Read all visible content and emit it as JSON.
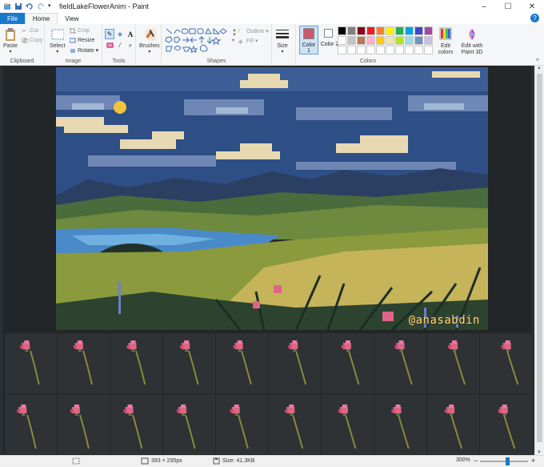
{
  "window": {
    "title": "fieldLakeFlowerAnim - Paint",
    "controls": [
      "–",
      "☐",
      "✕"
    ]
  },
  "tabs": [
    {
      "label": "File"
    },
    {
      "label": "Home"
    },
    {
      "label": "View"
    }
  ],
  "ribbon": {
    "clipboard": {
      "label": "Clipboard",
      "paste": "Paste",
      "cut": "Cut",
      "copy": "Copy"
    },
    "image": {
      "label": "Image",
      "select": "Select",
      "crop": "Crop",
      "resize": "Resize",
      "rotate": "Rotate"
    },
    "tools": {
      "label": "Tools"
    },
    "brushes": {
      "label": "Brushes"
    },
    "shapes": {
      "label": "Shapes",
      "outline": "Outline",
      "fill": "Fill"
    },
    "size": {
      "label": "Size"
    },
    "colors": {
      "label": "Colors",
      "color1": "Color 1",
      "color2": "Color 2",
      "edit": "Edit colors",
      "edit3d": "Edit with Paint 3D",
      "color1_value": "#c85a6e",
      "color2_value": "#ffffff",
      "palette": [
        "#000000",
        "#7f7f7f",
        "#880015",
        "#ed1c24",
        "#ff7f27",
        "#fff200",
        "#22b14c",
        "#00a2e8",
        "#3f48cc",
        "#a349a4",
        "#ffffff",
        "#c3c3c3",
        "#b97a57",
        "#ffaec9",
        "#ffc90e",
        "#efe4b0",
        "#b5e61d",
        "#99d9ea",
        "#7092be",
        "#c8bfe7",
        "#ffffff",
        "#ffffff",
        "#ffffff",
        "#ffffff",
        "#ffffff",
        "#ffffff",
        "#ffffff",
        "#ffffff",
        "#ffffff",
        "#ffffff"
      ]
    }
  },
  "canvas": {
    "watermark": "@anasabdin",
    "frame_count": 20
  },
  "status": {
    "dimensions": "393 × 295px",
    "size": "Size: 41.3KB",
    "zoom": "300%"
  }
}
